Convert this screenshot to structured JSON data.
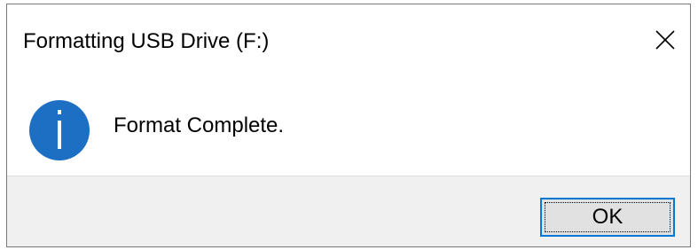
{
  "dialog": {
    "title": "Formatting USB Drive (F:)",
    "message": "Format Complete.",
    "ok_label": "OK"
  },
  "icons": {
    "info": "info-icon",
    "close": "close-icon"
  },
  "colors": {
    "accent": "#0078d7",
    "info_icon": "#1d6fc4",
    "footer_bg": "#f0f0f0",
    "button_bg": "#e1e1e1"
  }
}
